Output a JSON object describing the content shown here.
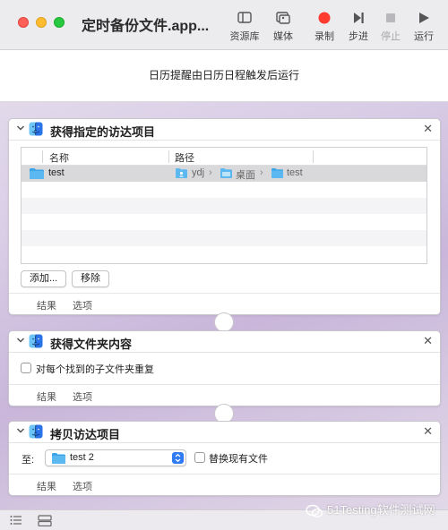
{
  "window": {
    "title": "定时备份文件.app...",
    "toolbar": {
      "library": "资源库",
      "media": "媒体",
      "record": "录制",
      "step": "步进",
      "stop": "停止",
      "run": "运行"
    }
  },
  "banner": {
    "text": "日历提醒由日历日程触发后运行"
  },
  "actions": [
    {
      "title": "获得指定的访达项目",
      "columns": [
        "名称",
        "路径"
      ],
      "rows": [
        {
          "name": "test",
          "path": [
            "ydj",
            "桌面",
            "test"
          ],
          "separator": "›"
        }
      ],
      "add_label": "添加...",
      "remove_label": "移除",
      "results_tab": "结果",
      "options_tab": "选项"
    },
    {
      "title": "获得文件夹内容",
      "checkbox_label": "对每个找到的子文件夹重复",
      "checkbox_checked": false,
      "results_tab": "结果",
      "options_tab": "选项"
    },
    {
      "title": "拷贝访达项目",
      "to_label": "至:",
      "destination": "test 2",
      "replace_label": "替换现有文件",
      "replace_checked": false,
      "results_tab": "结果",
      "options_tab": "选项"
    }
  ],
  "close_glyph": "✕",
  "watermark": "51Testing软件测试网",
  "colors": {
    "accent": "#2f7bf5",
    "folder": "#3ba3e8",
    "record": "#ff3b30"
  },
  "icons": [
    "library-icon",
    "media-icon",
    "record-icon",
    "step-icon",
    "stop-icon",
    "run-icon",
    "finder-icon",
    "folder-icon",
    "list-view-icon",
    "workflow-view-icon",
    "wechat-icon"
  ]
}
